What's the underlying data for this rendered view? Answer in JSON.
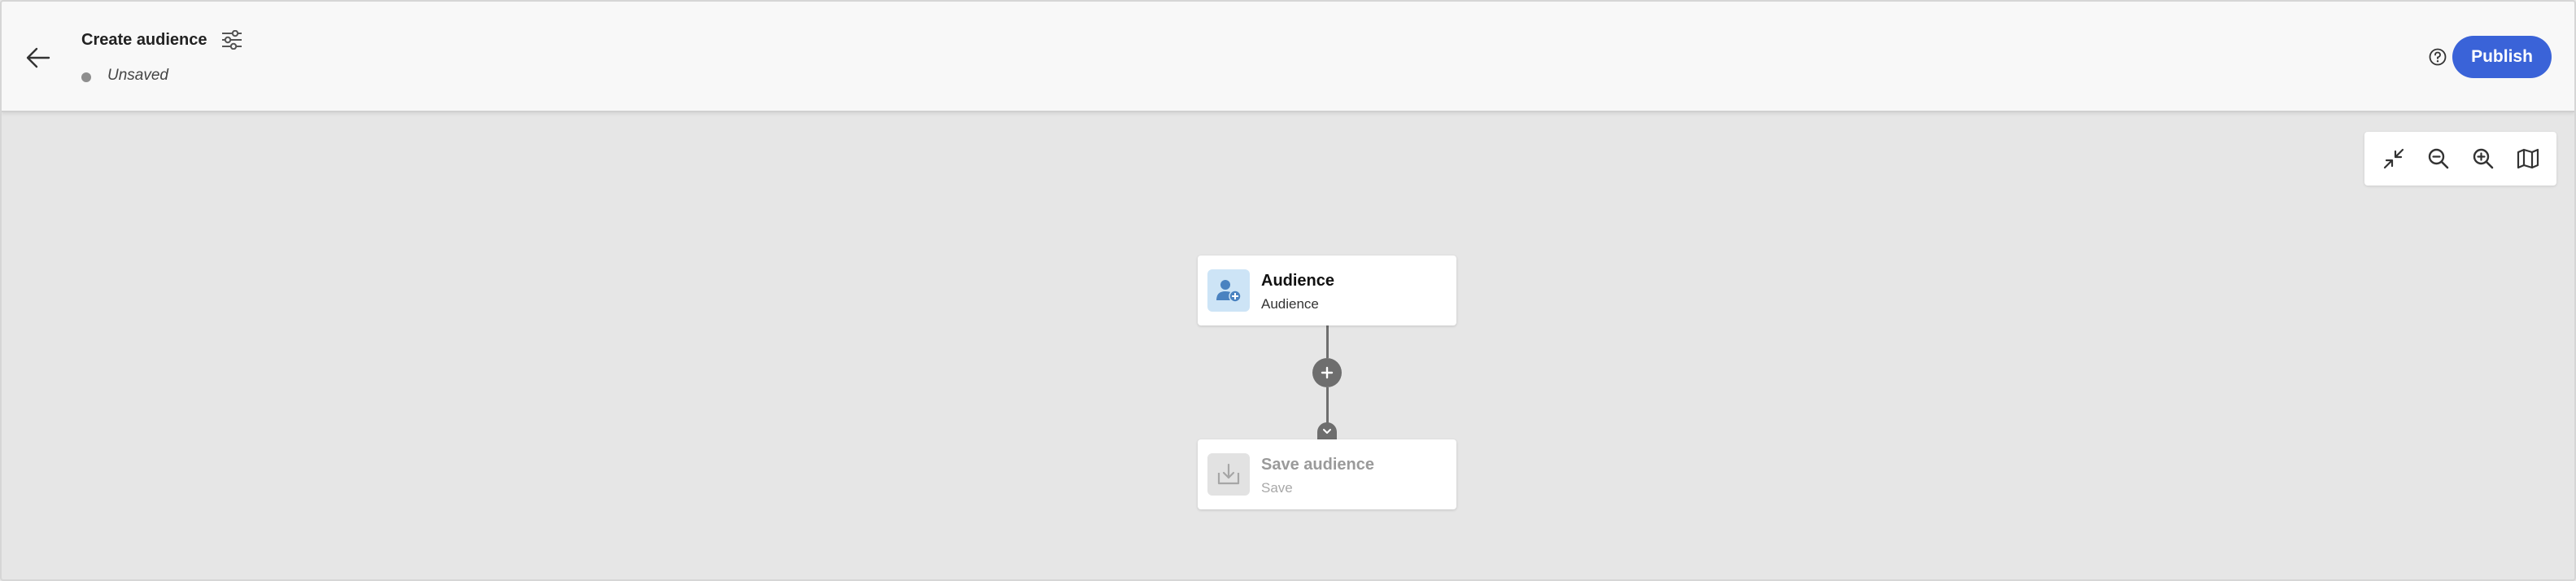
{
  "header": {
    "title": "Create audience",
    "status": "Unsaved",
    "publish_label": "Publish",
    "back_icon": "arrow-left-icon",
    "settings_icon": "sliders-icon",
    "help_icon": "help-circle-icon"
  },
  "toolbar": {
    "icons": [
      "collapse-icon",
      "zoom-out-icon",
      "zoom-in-icon",
      "map-icon"
    ]
  },
  "canvas": {
    "nodes": [
      {
        "title": "Audience",
        "subtitle": "Audience",
        "icon": "audience-add-icon",
        "state": "active"
      },
      {
        "title": "Save audience",
        "subtitle": "Save",
        "icon": "save-download-icon",
        "state": "disabled"
      }
    ],
    "add_icon": "plus-icon",
    "handle_icon": "chevron-down-icon"
  },
  "colors": {
    "accent": "#3a63d8",
    "canvas_bg": "#e6e6e6",
    "header_bg": "#f8f8f8",
    "connector": "#6e6e6e",
    "audience_icon_bg": "#cde4f6"
  }
}
